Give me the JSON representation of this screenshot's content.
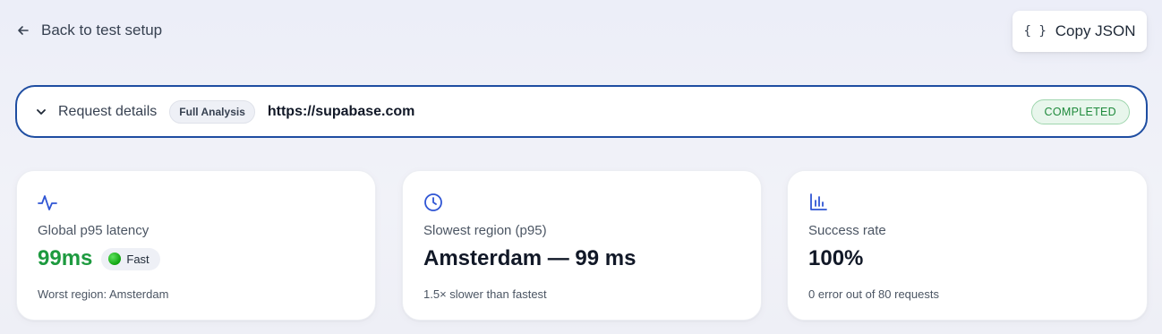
{
  "header": {
    "back_label": "Back to test setup",
    "copy_label": "Copy JSON",
    "copy_icon_glyph": "{ }"
  },
  "request": {
    "label": "Request details",
    "analysis_pill": "Full Analysis",
    "url": "https://supabase.com",
    "status": "COMPLETED"
  },
  "cards": {
    "latency": {
      "icon": "activity-icon",
      "title": "Global p95 latency",
      "value": "99ms",
      "badge": "Fast",
      "sub": "Worst region: Amsterdam"
    },
    "slowest": {
      "icon": "clock-icon",
      "title": "Slowest region (p95)",
      "value": "Amsterdam — 99 ms",
      "sub": "1.5× slower than fastest"
    },
    "success": {
      "icon": "bar-chart-icon",
      "title": "Success rate",
      "value": "100%",
      "sub": "0 error out of 80 requests"
    }
  },
  "colors": {
    "accent": "#1e4da1",
    "icon_blue": "#2f55d4",
    "success_green": "#1d9a3f",
    "status_bg": "#e8f6ec"
  }
}
